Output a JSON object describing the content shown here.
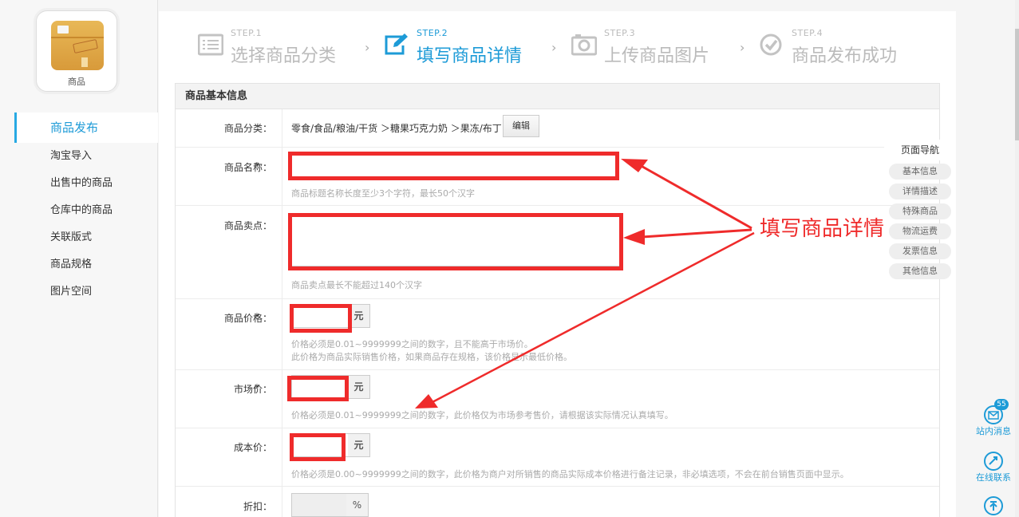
{
  "app": {
    "name": "商品"
  },
  "sidebar": {
    "items": [
      {
        "label": "商品发布",
        "active": true
      },
      {
        "label": "淘宝导入"
      },
      {
        "label": "出售中的商品"
      },
      {
        "label": "仓库中的商品"
      },
      {
        "label": "关联版式"
      },
      {
        "label": "商品规格"
      },
      {
        "label": "图片空间"
      }
    ]
  },
  "steps": [
    {
      "num": "STEP.1",
      "title": "选择商品分类",
      "icon": "list-icon"
    },
    {
      "num": "STEP.2",
      "title": "填写商品详情",
      "icon": "edit-icon",
      "active": true
    },
    {
      "num": "STEP.3",
      "title": "上传商品图片",
      "icon": "camera-icon"
    },
    {
      "num": "STEP.4",
      "title": "商品发布成功",
      "icon": "check-circle-icon"
    }
  ],
  "form": {
    "section_title": "商品基本信息",
    "category": {
      "label": "商品分类：",
      "value": "零食/食品/粮油/干货 ＞糖果巧克力奶 ＞果冻/布丁",
      "edit_label": "编辑"
    },
    "name": {
      "required_mark": "*",
      "label": "商品名称：",
      "value": "",
      "hint": "商品标题名称长度至少3个字符，最长50个汉字"
    },
    "selling_point": {
      "label": "商品卖点：",
      "value": "",
      "hint": "商品卖点最长不能超过140个汉字"
    },
    "price": {
      "required_mark": "*",
      "label": "商品价格：",
      "unit": "元",
      "hint1": "价格必须是0.01~9999999之间的数字，且不能高于市场价。",
      "hint2": "此价格为商品实际销售价格，如果商品存在规格，该价格显示最低价格。"
    },
    "market_price": {
      "required_mark": "*",
      "label": "市场价：",
      "unit": "元",
      "hint": "价格必须是0.01~9999999之间的数字，此价格仅为市场参考售价，请根据该实际情况认真填写。"
    },
    "cost_price": {
      "label": "成本价：",
      "unit": "元",
      "hint": "价格必须是0.00~9999999之间的数字，此价格为商户对所销售的商品实际成本价格进行备注记录，非必填选项，不会在前台销售页面中显示。"
    },
    "discount": {
      "label": "折扣：",
      "unit": "%"
    }
  },
  "page_nav": {
    "title": "页面导航",
    "items": [
      "基本信息",
      "详情描述",
      "特殊商品",
      "物流运费",
      "发票信息",
      "其他信息"
    ]
  },
  "annotation": {
    "text": "填写商品详情",
    "color": "#ef2b2b"
  },
  "tools": [
    {
      "label": "站内消息",
      "icon": "mail-icon",
      "badge": "55"
    },
    {
      "label": "在线联系",
      "icon": "chat-icon"
    },
    {
      "label": "",
      "icon": "back-to-top-icon"
    }
  ],
  "colors": {
    "accent": "#1d9bd7",
    "annotation_red": "#ef2b2b"
  }
}
